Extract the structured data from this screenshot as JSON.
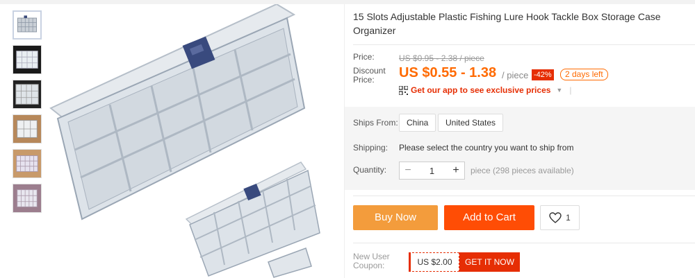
{
  "product": {
    "title": "15 Slots Adjustable Plastic Fishing Lure Hook Tackle Box Storage Case Organizer"
  },
  "thumbnails": [
    {
      "name": "thumb-1",
      "active": true
    },
    {
      "name": "thumb-2",
      "active": false
    },
    {
      "name": "thumb-3",
      "active": false
    },
    {
      "name": "thumb-4",
      "active": false
    },
    {
      "name": "thumb-5",
      "active": false
    },
    {
      "name": "thumb-6",
      "active": false
    }
  ],
  "price": {
    "price_label": "Price:",
    "original": "US $0.95 - 2.38 / piece",
    "discount_label_line1": "Discount",
    "discount_label_line2": "Price:",
    "discount_value": "US $0.55 - 1.38",
    "per_unit": "/ piece",
    "discount_percent": "-42%",
    "time_left": "2 days left",
    "app_promo": "Get our app to see exclusive prices",
    "app_icon": "qr-code-icon"
  },
  "shipping": {
    "ships_from_label": "Ships From:",
    "origins": [
      "China",
      "United States"
    ],
    "shipping_label": "Shipping:",
    "shipping_text": "Please select the country you want to ship from"
  },
  "quantity": {
    "label": "Quantity:",
    "minus": "−",
    "value": "1",
    "plus": "+",
    "note": "piece (298 pieces available)"
  },
  "actions": {
    "buy_now": "Buy Now",
    "add_to_cart": "Add to Cart",
    "wishlist_count": "1",
    "wishlist_icon": "heart-icon"
  },
  "coupon": {
    "label_line1": "New User",
    "label_line2": "Coupon:",
    "amount": "US $2.00",
    "cta": "GET IT NOW"
  },
  "colors": {
    "orange": "#ff6a00",
    "red": "#e62e04",
    "buy_now_bg": "#f39c3c",
    "add_to_cart_bg": "#ff4d05"
  }
}
